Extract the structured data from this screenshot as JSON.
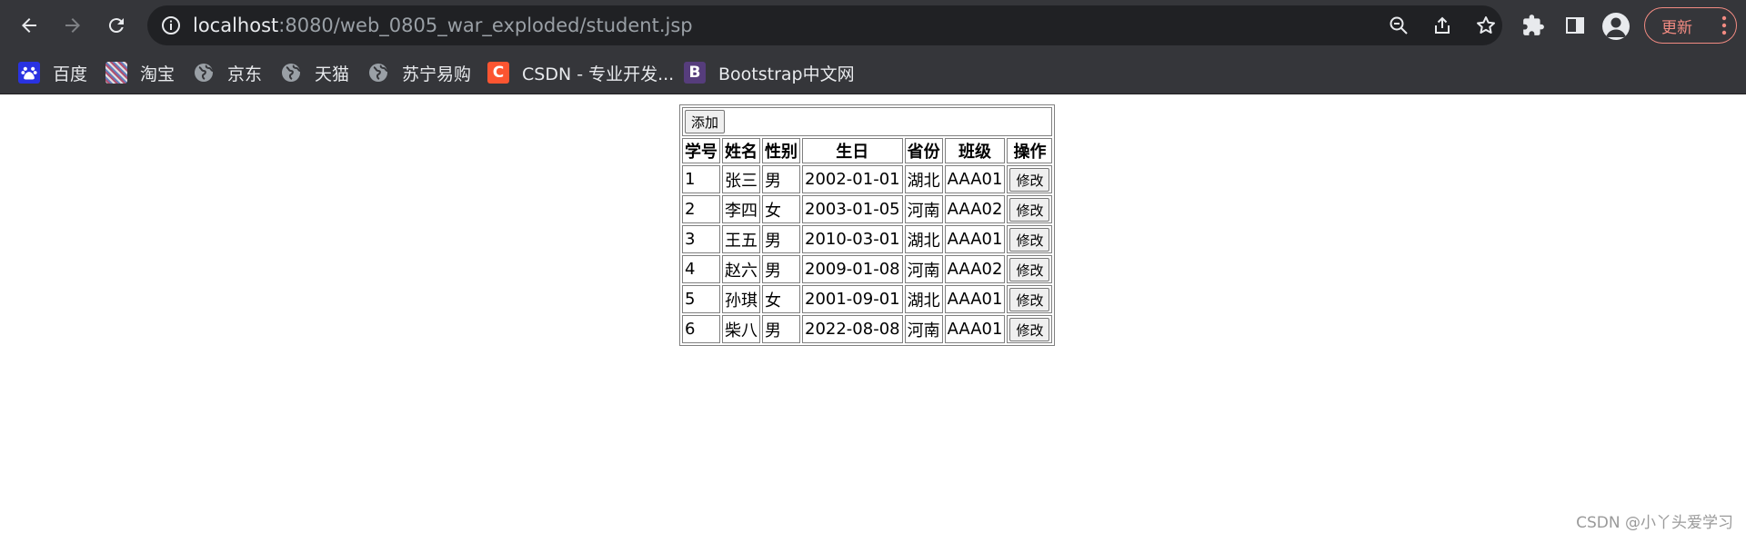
{
  "browser": {
    "url_host": "localhost",
    "url_path": ":8080/web_0805_war_exploded/student.jsp",
    "update_label": "更新"
  },
  "bookmarks": [
    {
      "label": "百度",
      "icon": "baidu-icon"
    },
    {
      "label": "淘宝",
      "icon": "taobao-icon"
    },
    {
      "label": "京东",
      "icon": "globe-icon"
    },
    {
      "label": "天猫",
      "icon": "globe-icon"
    },
    {
      "label": "苏宁易购",
      "icon": "globe-icon"
    },
    {
      "label": "CSDN - 专业开发...",
      "icon": "csdn-icon",
      "glyph": "C",
      "color": "#fc5531"
    },
    {
      "label": "Bootstrap中文网",
      "icon": "bootstrap-icon",
      "glyph": "B",
      "color": "#563d7c"
    }
  ],
  "table": {
    "add_label": "添加",
    "columns": [
      "学号",
      "姓名",
      "性别",
      "生日",
      "省份",
      "班级",
      "操作"
    ],
    "edit_label": "修改",
    "rows": [
      [
        "1",
        "张三",
        "男",
        "2002-01-01",
        "湖北",
        "AAA01"
      ],
      [
        "2",
        "李四",
        "女",
        "2003-01-05",
        "河南",
        "AAA02"
      ],
      [
        "3",
        "王五",
        "男",
        "2010-03-01",
        "湖北",
        "AAA01"
      ],
      [
        "4",
        "赵六",
        "男",
        "2009-01-08",
        "河南",
        "AAA02"
      ],
      [
        "5",
        "孙琪",
        "女",
        "2001-09-01",
        "湖北",
        "AAA01"
      ],
      [
        "6",
        "柴八",
        "男",
        "2022-08-08",
        "河南",
        "AAA01"
      ]
    ]
  },
  "watermark": "CSDN @小丫头爱学习"
}
